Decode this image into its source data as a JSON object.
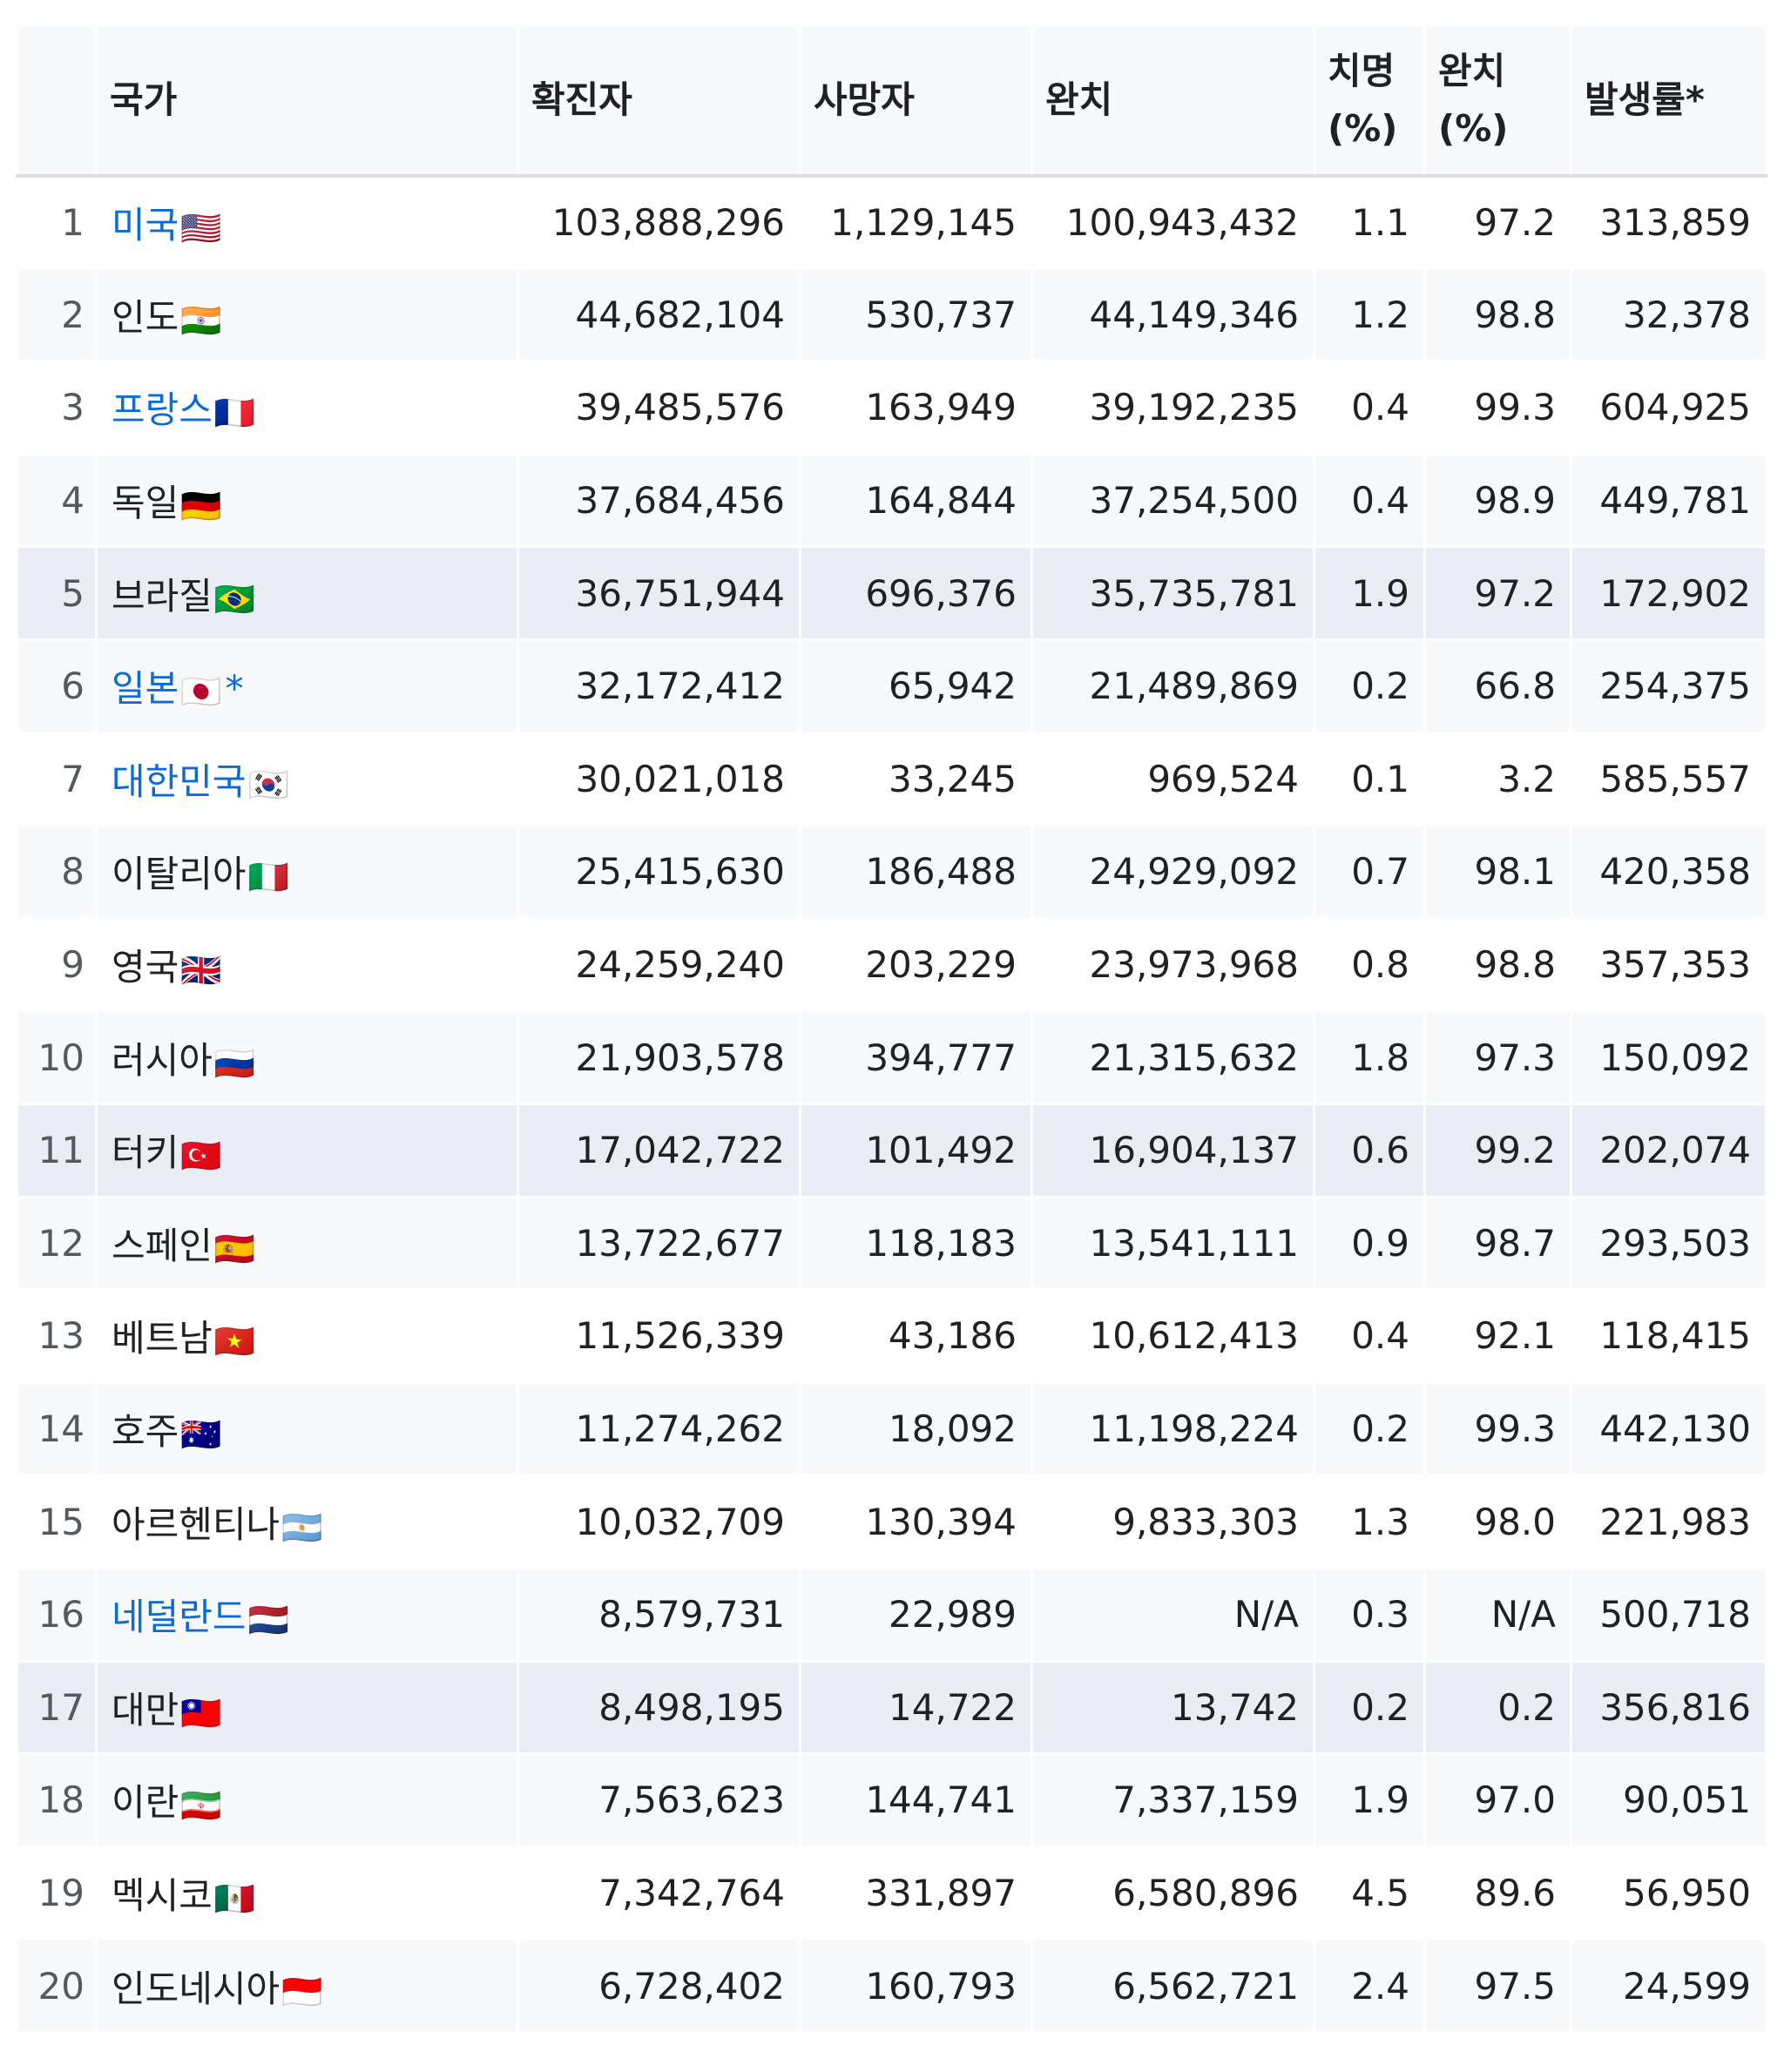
{
  "headers": {
    "rank": "",
    "country": "국가",
    "confirmed": "확진자",
    "deaths": "사망자",
    "recovered": "완치",
    "fatality_line1": "치명",
    "fatality_line2": "(%)",
    "recovery_line1": "완치",
    "recovery_line2": "(%)",
    "incidence": "발생률*"
  },
  "colors": {
    "link": "#0b6ad8",
    "header_bg": "#f8f9fa",
    "zebra_bg": "#f8f9fa",
    "highlight_bg": "#eaecf6"
  },
  "rows": [
    {
      "rank": "1",
      "country": "미국",
      "flag": "🇺🇸",
      "link": true,
      "confirmed": "103,888,296",
      "deaths": "1,129,145",
      "recovered": "100,943,432",
      "fatality": "1.1",
      "recovery": "97.2",
      "incidence": "313,859"
    },
    {
      "rank": "2",
      "country": "인도",
      "flag": "🇮🇳",
      "link": false,
      "confirmed": "44,682,104",
      "deaths": "530,737",
      "recovered": "44,149,346",
      "fatality": "1.2",
      "recovery": "98.8",
      "incidence": "32,378"
    },
    {
      "rank": "3",
      "country": "프랑스",
      "flag": "🇫🇷",
      "link": true,
      "confirmed": "39,485,576",
      "deaths": "163,949",
      "recovered": "39,192,235",
      "fatality": "0.4",
      "recovery": "99.3",
      "incidence": "604,925"
    },
    {
      "rank": "4",
      "country": "독일",
      "flag": "🇩🇪",
      "link": false,
      "confirmed": "37,684,456",
      "deaths": "164,844",
      "recovered": "37,254,500",
      "fatality": "0.4",
      "recovery": "98.9",
      "incidence": "449,781"
    },
    {
      "rank": "5",
      "country": "브라질",
      "flag": "🇧🇷",
      "link": false,
      "highlight": true,
      "confirmed": "36,751,944",
      "deaths": "696,376",
      "recovered": "35,735,781",
      "fatality": "1.9",
      "recovery": "97.2",
      "incidence": "172,902"
    },
    {
      "rank": "6",
      "country": "일본",
      "flag": "🇯🇵",
      "link": true,
      "note": "*",
      "confirmed": "32,172,412",
      "deaths": "65,942",
      "recovered": "21,489,869",
      "fatality": "0.2",
      "recovery": "66.8",
      "incidence": "254,375"
    },
    {
      "rank": "7",
      "country": "대한민국",
      "flag": "🇰🇷",
      "link": true,
      "confirmed": "30,021,018",
      "deaths": "33,245",
      "recovered": "969,524",
      "fatality": "0.1",
      "recovery": "3.2",
      "incidence": "585,557"
    },
    {
      "rank": "8",
      "country": "이탈리아",
      "flag": "🇮🇹",
      "link": false,
      "confirmed": "25,415,630",
      "deaths": "186,488",
      "recovered": "24,929,092",
      "fatality": "0.7",
      "recovery": "98.1",
      "incidence": "420,358"
    },
    {
      "rank": "9",
      "country": "영국",
      "flag": "🇬🇧",
      "link": false,
      "confirmed": "24,259,240",
      "deaths": "203,229",
      "recovered": "23,973,968",
      "fatality": "0.8",
      "recovery": "98.8",
      "incidence": "357,353"
    },
    {
      "rank": "10",
      "country": "러시아",
      "flag": "🇷🇺",
      "link": false,
      "confirmed": "21,903,578",
      "deaths": "394,777",
      "recovered": "21,315,632",
      "fatality": "1.8",
      "recovery": "97.3",
      "incidence": "150,092"
    },
    {
      "rank": "11",
      "country": "터키",
      "flag": "🇹🇷",
      "link": false,
      "highlight": true,
      "confirmed": "17,042,722",
      "deaths": "101,492",
      "recovered": "16,904,137",
      "fatality": "0.6",
      "recovery": "99.2",
      "incidence": "202,074"
    },
    {
      "rank": "12",
      "country": "스페인",
      "flag": "🇪🇸",
      "link": false,
      "confirmed": "13,722,677",
      "deaths": "118,183",
      "recovered": "13,541,111",
      "fatality": "0.9",
      "recovery": "98.7",
      "incidence": "293,503"
    },
    {
      "rank": "13",
      "country": "베트남",
      "flag": "🇻🇳",
      "link": false,
      "confirmed": "11,526,339",
      "deaths": "43,186",
      "recovered": "10,612,413",
      "fatality": "0.4",
      "recovery": "92.1",
      "incidence": "118,415"
    },
    {
      "rank": "14",
      "country": "호주",
      "flag": "🇦🇺",
      "link": false,
      "confirmed": "11,274,262",
      "deaths": "18,092",
      "recovered": "11,198,224",
      "fatality": "0.2",
      "recovery": "99.3",
      "incidence": "442,130"
    },
    {
      "rank": "15",
      "country": "아르헨티나",
      "flag": "🇦🇷",
      "link": false,
      "confirmed": "10,032,709",
      "deaths": "130,394",
      "recovered": "9,833,303",
      "fatality": "1.3",
      "recovery": "98.0",
      "incidence": "221,983"
    },
    {
      "rank": "16",
      "country": "네덜란드",
      "flag": "🇳🇱",
      "link": true,
      "confirmed": "8,579,731",
      "deaths": "22,989",
      "recovered": "N/A",
      "fatality": "0.3",
      "recovery": "N/A",
      "incidence": "500,718"
    },
    {
      "rank": "17",
      "country": "대만",
      "flag": "🇹🇼",
      "link": false,
      "highlight": true,
      "confirmed": "8,498,195",
      "deaths": "14,722",
      "recovered": "13,742",
      "fatality": "0.2",
      "recovery": "0.2",
      "incidence": "356,816"
    },
    {
      "rank": "18",
      "country": "이란",
      "flag": "🇮🇷",
      "link": false,
      "confirmed": "7,563,623",
      "deaths": "144,741",
      "recovered": "7,337,159",
      "fatality": "1.9",
      "recovery": "97.0",
      "incidence": "90,051"
    },
    {
      "rank": "19",
      "country": "멕시코",
      "flag": "🇲🇽",
      "link": false,
      "confirmed": "7,342,764",
      "deaths": "331,897",
      "recovered": "6,580,896",
      "fatality": "4.5",
      "recovery": "89.6",
      "incidence": "56,950"
    },
    {
      "rank": "20",
      "country": "인도네시아",
      "flag": "🇮🇩",
      "link": false,
      "confirmed": "6,728,402",
      "deaths": "160,793",
      "recovered": "6,562,721",
      "fatality": "2.4",
      "recovery": "97.5",
      "incidence": "24,599"
    }
  ]
}
